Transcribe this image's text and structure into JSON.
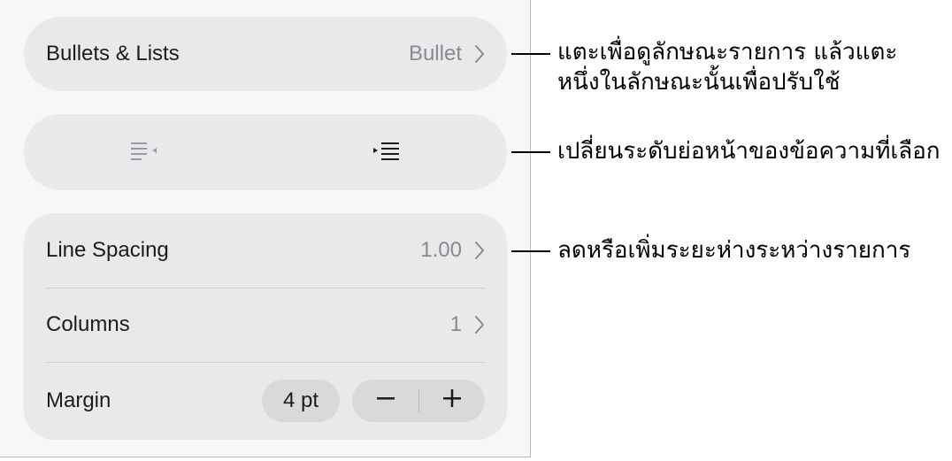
{
  "bullets_group": {
    "label": "Bullets & Lists",
    "value": "Bullet"
  },
  "indent_group": {
    "decrease_icon": "outdent-icon",
    "increase_icon": "indent-icon"
  },
  "spacing_group": {
    "line_spacing_label": "Line Spacing",
    "line_spacing_value": "1.00",
    "columns_label": "Columns",
    "columns_value": "1",
    "margin_label": "Margin",
    "margin_value": "4 pt",
    "minus_label": "−",
    "plus_label": "+"
  },
  "callouts": {
    "bullets_line1": "แตะเพื่อดูลักษณะรายการ แล้วแตะ",
    "bullets_line2": "หนึ่งในลักษณะนั้นเพื่อปรับใช้",
    "indent": "เปลี่ยนระดับย่อหน้าของข้อความที่เลือก",
    "spacing": "ลดหรือเพิ่มระยะห่างระหว่างรายการ"
  },
  "colors": {
    "panel_bg": "#f7f7f7",
    "group_bg": "#e9e9eb",
    "secondary_text": "#8a8a8e",
    "pill_bg": "#d9d9dc"
  }
}
